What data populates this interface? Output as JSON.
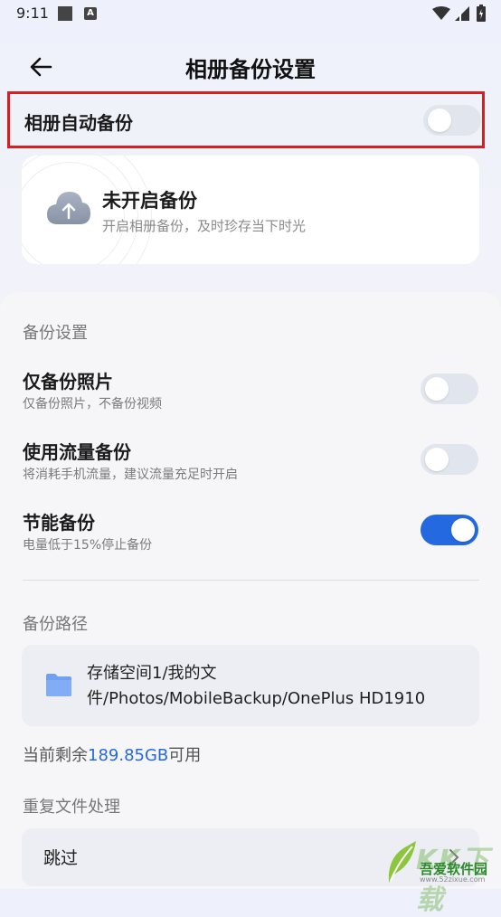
{
  "status_bar": {
    "time": "9:11",
    "a_badge": "A",
    "icons": [
      "square-icon",
      "a-badge-icon",
      "wifi-icon",
      "signal-icon",
      "battery-icon"
    ]
  },
  "header": {
    "title": "相册备份设置",
    "back_icon": "back-arrow-icon"
  },
  "auto_backup": {
    "label": "相册自动备份",
    "enabled": false
  },
  "status_card": {
    "icon": "cloud-upload-icon",
    "title": "未开启备份",
    "description": "开启相册备份，及时珍存当下时光"
  },
  "backup_settings": {
    "section_title": "备份设置",
    "items": [
      {
        "title": "仅备份照片",
        "description": "仅备份照片，不备份视频",
        "enabled": false
      },
      {
        "title": "使用流量备份",
        "description": "将消耗手机流量，建议流量充足时开启",
        "enabled": false
      },
      {
        "title": "节能备份",
        "description": "电量低于15%停止备份",
        "enabled": true
      }
    ]
  },
  "backup_path": {
    "section_title": "备份路径",
    "icon": "folder-icon",
    "path": "存储空间1/我的文件/Photos/MobileBackup/OnePlus HD1910",
    "storage_prefix": "当前剩余",
    "storage_amount": "189.85GB",
    "storage_suffix": "可用"
  },
  "duplicate_handling": {
    "section_title": "重复文件处理",
    "selected": "跳过"
  },
  "watermark": {
    "name": "吾爱软件园",
    "url": "www.52zixue.com",
    "text": "KK下载"
  },
  "colors": {
    "accent": "#2469e0",
    "highlight_border": "#d81e1e",
    "toggle_off": "#e1e5ed"
  }
}
